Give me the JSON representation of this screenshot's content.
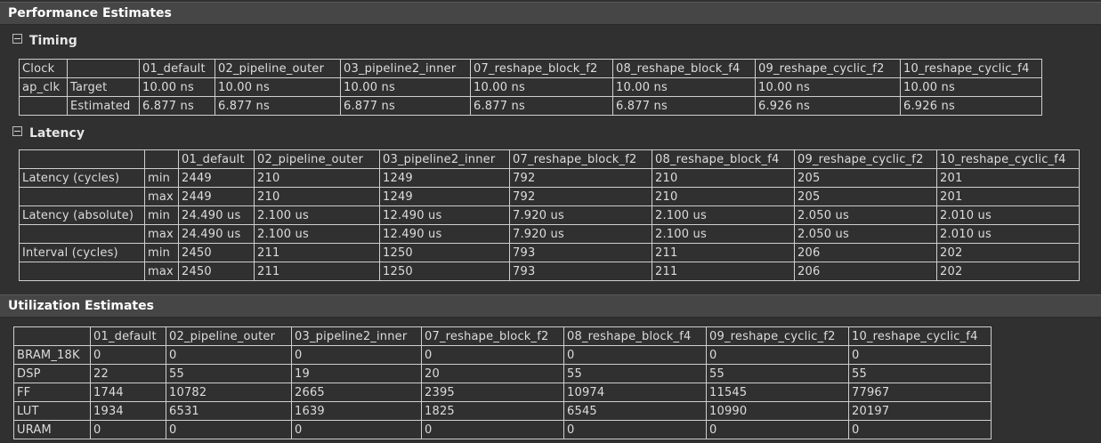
{
  "performance": {
    "header": "Performance Estimates",
    "timing": {
      "title": "Timing",
      "header_label": "Clock",
      "columns": [
        "01_default",
        "02_pipeline_outer",
        "03_pipeline2_inner",
        "07_reshape_block_f2",
        "08_reshape_block_f4",
        "09_reshape_cyclic_f2",
        "10_reshape_cyclic_f4"
      ],
      "clock": "ap_clk",
      "rows": [
        {
          "label": "Target",
          "values": [
            "10.00 ns",
            "10.00 ns",
            "10.00 ns",
            "10.00 ns",
            "10.00 ns",
            "10.00 ns",
            "10.00 ns"
          ]
        },
        {
          "label": "Estimated",
          "values": [
            "6.877 ns",
            "6.877 ns",
            "6.877 ns",
            "6.877 ns",
            "6.877 ns",
            "6.926 ns",
            "6.926 ns"
          ]
        }
      ]
    },
    "latency": {
      "title": "Latency",
      "columns": [
        "01_default",
        "02_pipeline_outer",
        "03_pipeline2_inner",
        "07_reshape_block_f2",
        "08_reshape_block_f4",
        "09_reshape_cyclic_f2",
        "10_reshape_cyclic_f4"
      ],
      "groups": [
        {
          "label": "Latency (cycles)",
          "rows": [
            {
              "sub": "min",
              "values": [
                "2449",
                "210",
                "1249",
                "792",
                "210",
                "205",
                "201"
              ]
            },
            {
              "sub": "max",
              "values": [
                "2449",
                "210",
                "1249",
                "792",
                "210",
                "205",
                "201"
              ]
            }
          ]
        },
        {
          "label": "Latency (absolute)",
          "rows": [
            {
              "sub": "min",
              "values": [
                "24.490 us",
                "2.100 us",
                "12.490 us",
                "7.920 us",
                "2.100 us",
                "2.050 us",
                "2.010 us"
              ]
            },
            {
              "sub": "max",
              "values": [
                "24.490 us",
                "2.100 us",
                "12.490 us",
                "7.920 us",
                "2.100 us",
                "2.050 us",
                "2.010 us"
              ]
            }
          ]
        },
        {
          "label": "Interval (cycles)",
          "rows": [
            {
              "sub": "min",
              "values": [
                "2450",
                "211",
                "1250",
                "793",
                "211",
                "206",
                "202"
              ]
            },
            {
              "sub": "max",
              "values": [
                "2450",
                "211",
                "1250",
                "793",
                "211",
                "206",
                "202"
              ]
            }
          ]
        }
      ]
    }
  },
  "utilization": {
    "header": "Utilization Estimates",
    "columns": [
      "01_default",
      "02_pipeline_outer",
      "03_pipeline2_inner",
      "07_reshape_block_f2",
      "08_reshape_block_f4",
      "09_reshape_cyclic_f2",
      "10_reshape_cyclic_f4"
    ],
    "rows": [
      {
        "label": "BRAM_18K",
        "values": [
          "0",
          "0",
          "0",
          "0",
          "0",
          "0",
          "0"
        ]
      },
      {
        "label": "DSP",
        "values": [
          "22",
          "55",
          "19",
          "20",
          "55",
          "55",
          "55"
        ]
      },
      {
        "label": "FF",
        "values": [
          "1744",
          "10782",
          "2665",
          "2395",
          "10974",
          "11545",
          "77967"
        ]
      },
      {
        "label": "LUT",
        "values": [
          "1934",
          "6531",
          "1639",
          "1825",
          "6545",
          "10990",
          "20197"
        ]
      },
      {
        "label": "URAM",
        "values": [
          "0",
          "0",
          "0",
          "0",
          "0",
          "0",
          "0"
        ]
      }
    ]
  }
}
